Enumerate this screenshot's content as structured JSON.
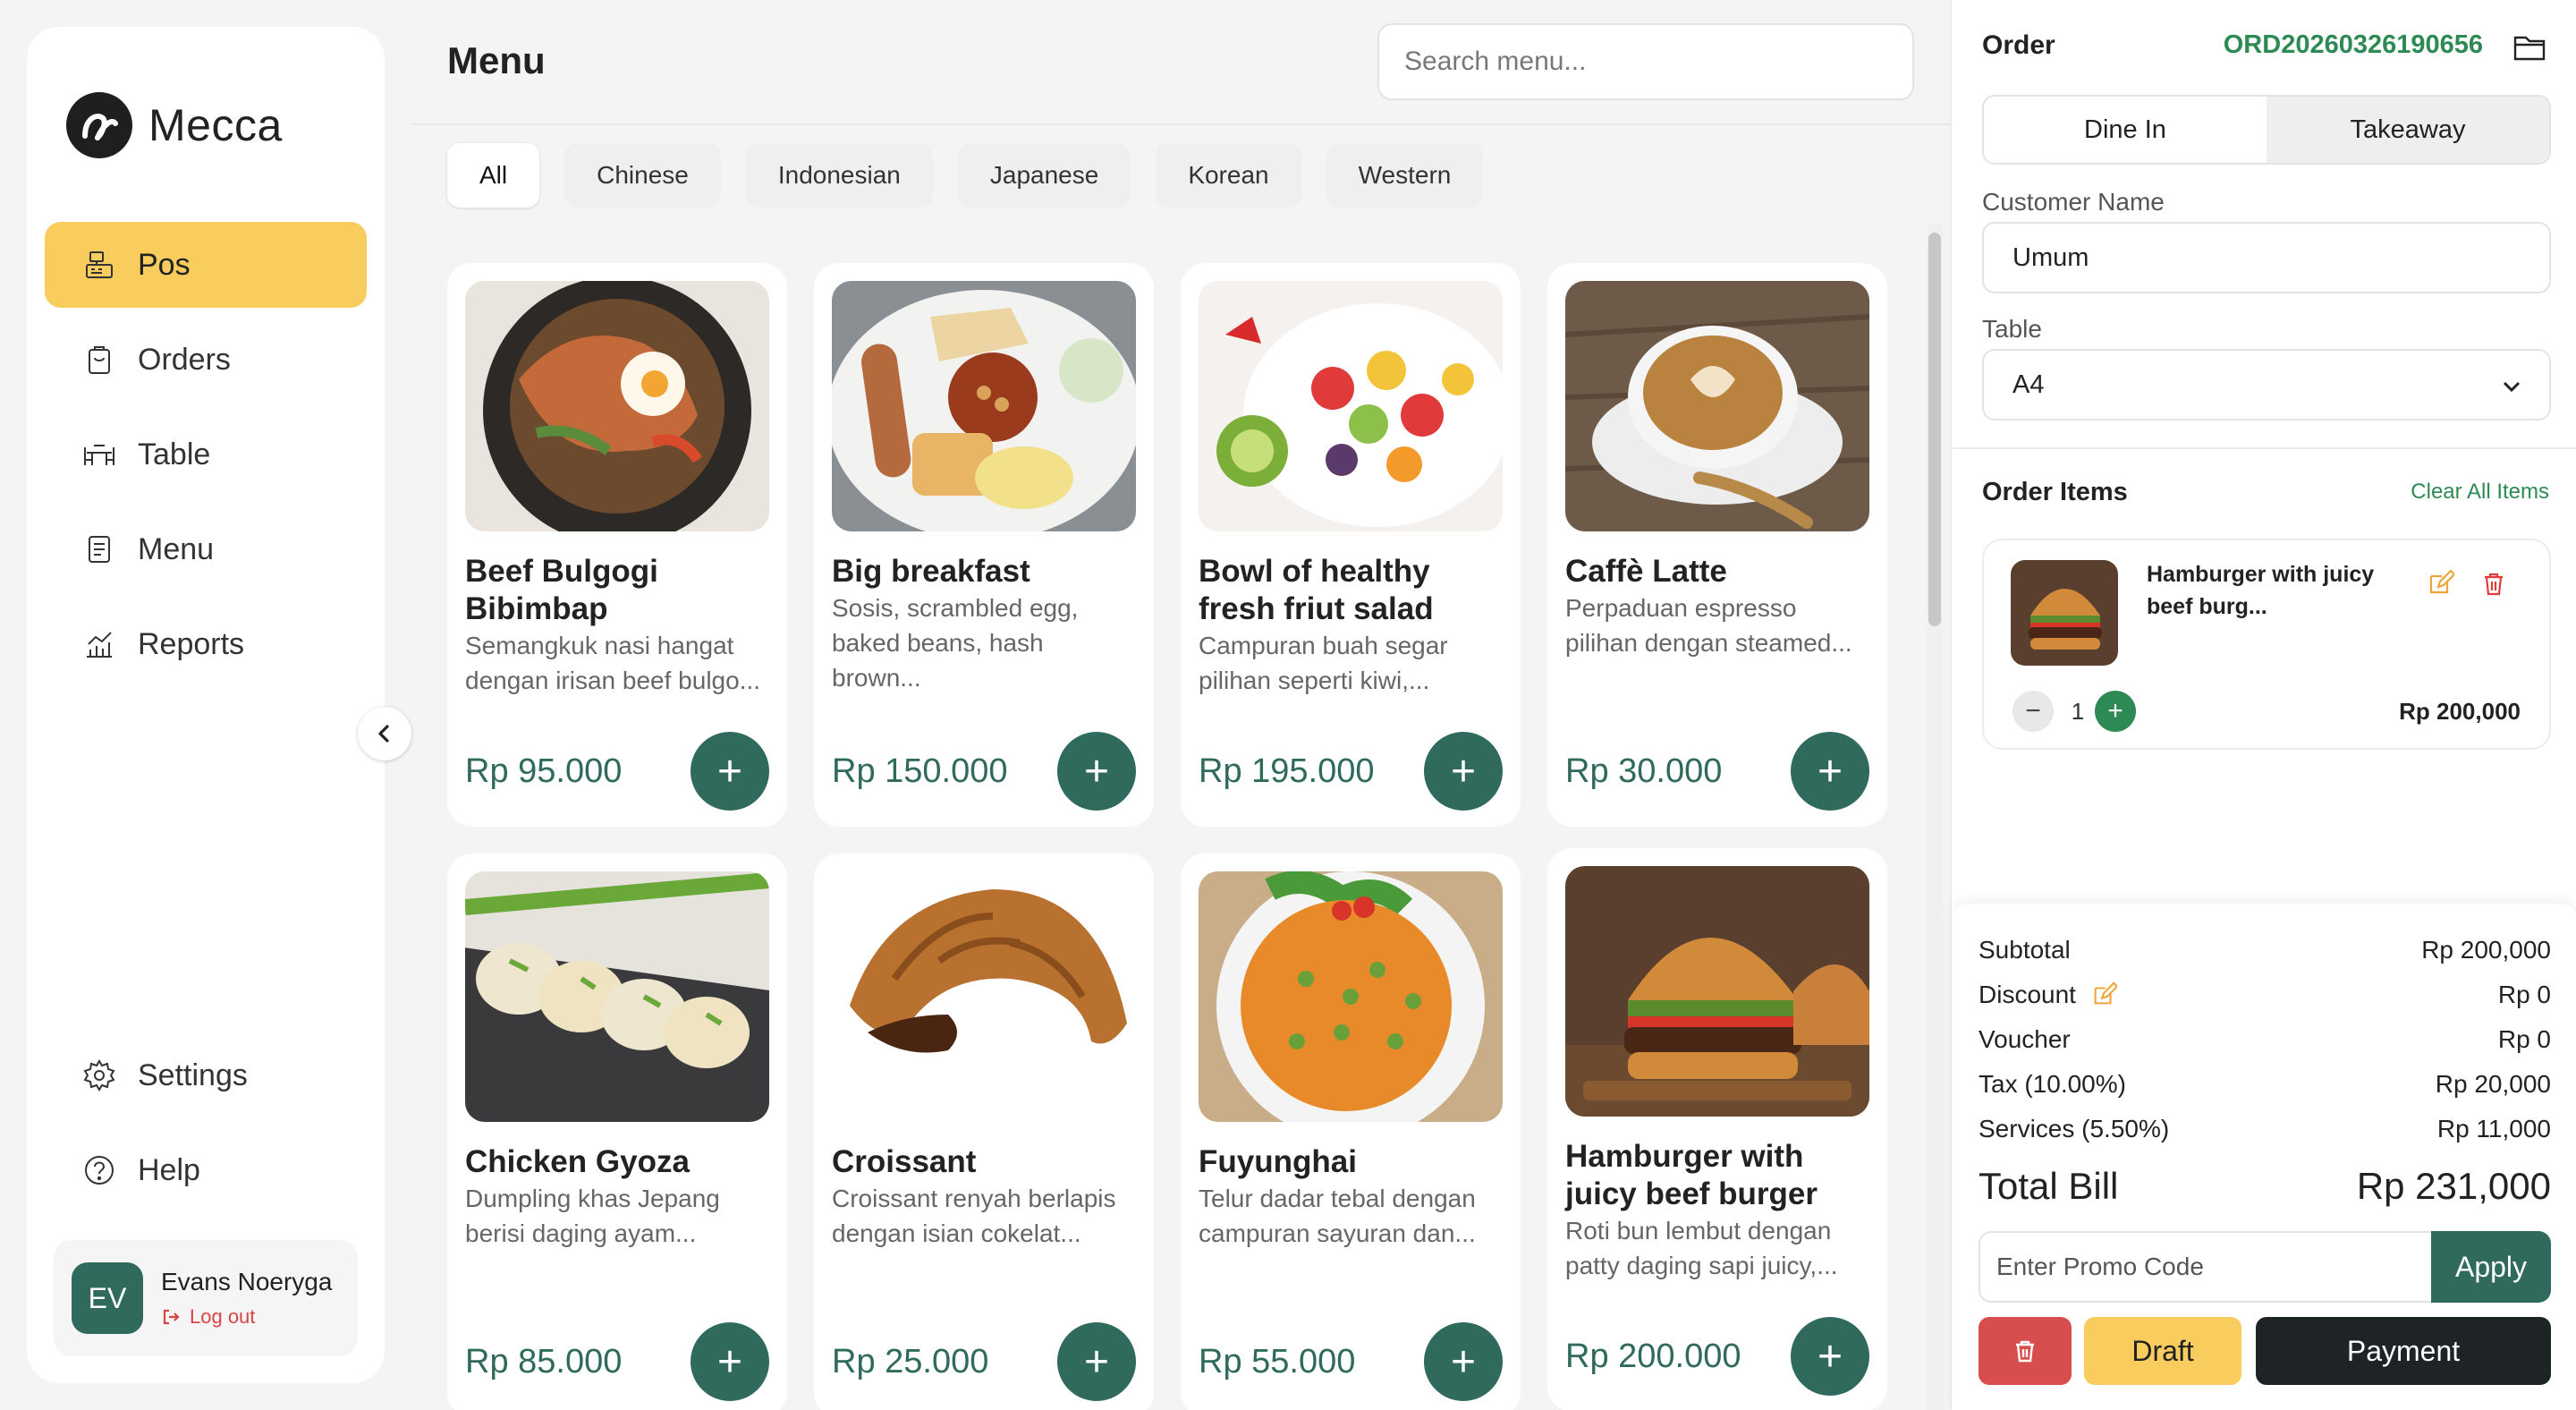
{
  "brand": {
    "name": "Mecca"
  },
  "nav": {
    "items": [
      {
        "label": "Pos",
        "icon": "pos-register-icon",
        "active": true
      },
      {
        "label": "Orders",
        "icon": "clipboard-icon",
        "active": false
      },
      {
        "label": "Table",
        "icon": "table-icon",
        "active": false
      },
      {
        "label": "Menu",
        "icon": "menu-list-icon",
        "active": false
      },
      {
        "label": "Reports",
        "icon": "chart-icon",
        "active": false
      }
    ],
    "bottom": [
      {
        "label": "Settings",
        "icon": "gear-icon"
      },
      {
        "label": "Help",
        "icon": "help-icon"
      }
    ]
  },
  "user": {
    "initials": "EV",
    "name": "Evans Noeryga",
    "logout": "Log out"
  },
  "main": {
    "title": "Menu",
    "search_placeholder": "Search menu...",
    "categories": [
      "All",
      "Chinese",
      "Indonesian",
      "Japanese",
      "Korean",
      "Western"
    ],
    "active_category": "All",
    "products": [
      {
        "name": "Beef Bulgogi Bibimbap",
        "desc": "Semangkuk nasi hangat dengan irisan beef bulgo...",
        "price": "Rp 95.000",
        "image": "bibimbap-image"
      },
      {
        "name": "Big breakfast",
        "desc": "Sosis, scrambled egg, baked beans, hash brown...",
        "price": "Rp 150.000",
        "image": "breakfast-image"
      },
      {
        "name": "Bowl of healthy fresh friut salad",
        "desc": "Campuran buah segar pilihan seperti kiwi,...",
        "price": "Rp 195.000",
        "image": "fruit-salad-image"
      },
      {
        "name": "Caffè Latte",
        "desc": "Perpaduan espresso pilihan dengan steamed...",
        "price": "Rp 30.000",
        "image": "latte-image"
      },
      {
        "name": "Chicken Gyoza",
        "desc": "Dumpling khas Jepang berisi daging ayam...",
        "price": "Rp 85.000",
        "image": "gyoza-image"
      },
      {
        "name": "Croissant",
        "desc": "Croissant renyah berlapis dengan isian cokelat...",
        "price": "Rp 25.000",
        "image": "croissant-image"
      },
      {
        "name": "Fuyunghai",
        "desc": "Telur dadar tebal dengan campuran sayuran dan...",
        "price": "Rp 55.000",
        "image": "fuyunghai-image"
      },
      {
        "name": "Hamburger with juicy beef burger",
        "desc": "Roti bun lembut dengan patty daging sapi juicy,...",
        "price": "Rp 200.000",
        "image": "burger-image"
      }
    ]
  },
  "order": {
    "label": "Order",
    "id": "ORD20260326190656",
    "modes": [
      "Dine In",
      "Takeaway"
    ],
    "active_mode": "Dine In",
    "customer_label": "Customer Name",
    "customer_value": "Umum",
    "table_label": "Table",
    "table_value": "A4",
    "items_title": "Order Items",
    "clear_all": "Clear All Items",
    "items": [
      {
        "name": "Hamburger with juicy beef burg...",
        "qty": "1",
        "price": "Rp 200,000"
      }
    ],
    "summary": {
      "subtotal_label": "Subtotal",
      "subtotal": "Rp 200,000",
      "discount_label": "Discount",
      "discount": "Rp 0",
      "voucher_label": "Voucher",
      "voucher": "Rp 0",
      "tax_label": "Tax (10.00%)",
      "tax": "Rp 20,000",
      "services_label": "Services (5.50%)",
      "services": "Rp 11,000",
      "total_label": "Total Bill",
      "total": "Rp 231,000"
    },
    "promo_placeholder": "Enter Promo Code",
    "apply": "Apply",
    "draft": "Draft",
    "payment": "Payment"
  },
  "colors": {
    "accent_green": "#2f6a5d",
    "brand_yellow": "#f8cd5e",
    "order_id_green": "#2e8a55",
    "danger_red": "#d84d4d",
    "payment_dark": "#1e2426"
  }
}
